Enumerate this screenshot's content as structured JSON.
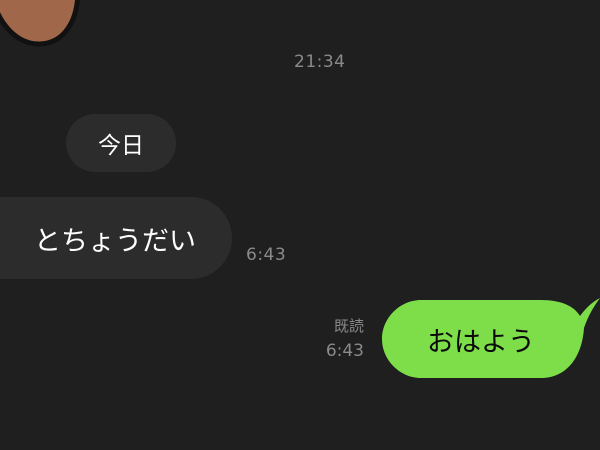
{
  "colors": {
    "background": "#1f1f1f",
    "incoming_bubble": "#2c2c2c",
    "outgoing_bubble": "#7dde4a",
    "meta_text": "#8a8a8a",
    "sticker_skin": "#a0674a"
  },
  "messages": {
    "top_time": "21:34",
    "date_divider": "今日",
    "incoming": {
      "text": "とちょうだい",
      "time": "6:43"
    },
    "outgoing": {
      "text": "おはよう",
      "read_label": "既読",
      "time": "6:43"
    }
  },
  "sticker": {
    "icon": "character-sticker-icon"
  }
}
